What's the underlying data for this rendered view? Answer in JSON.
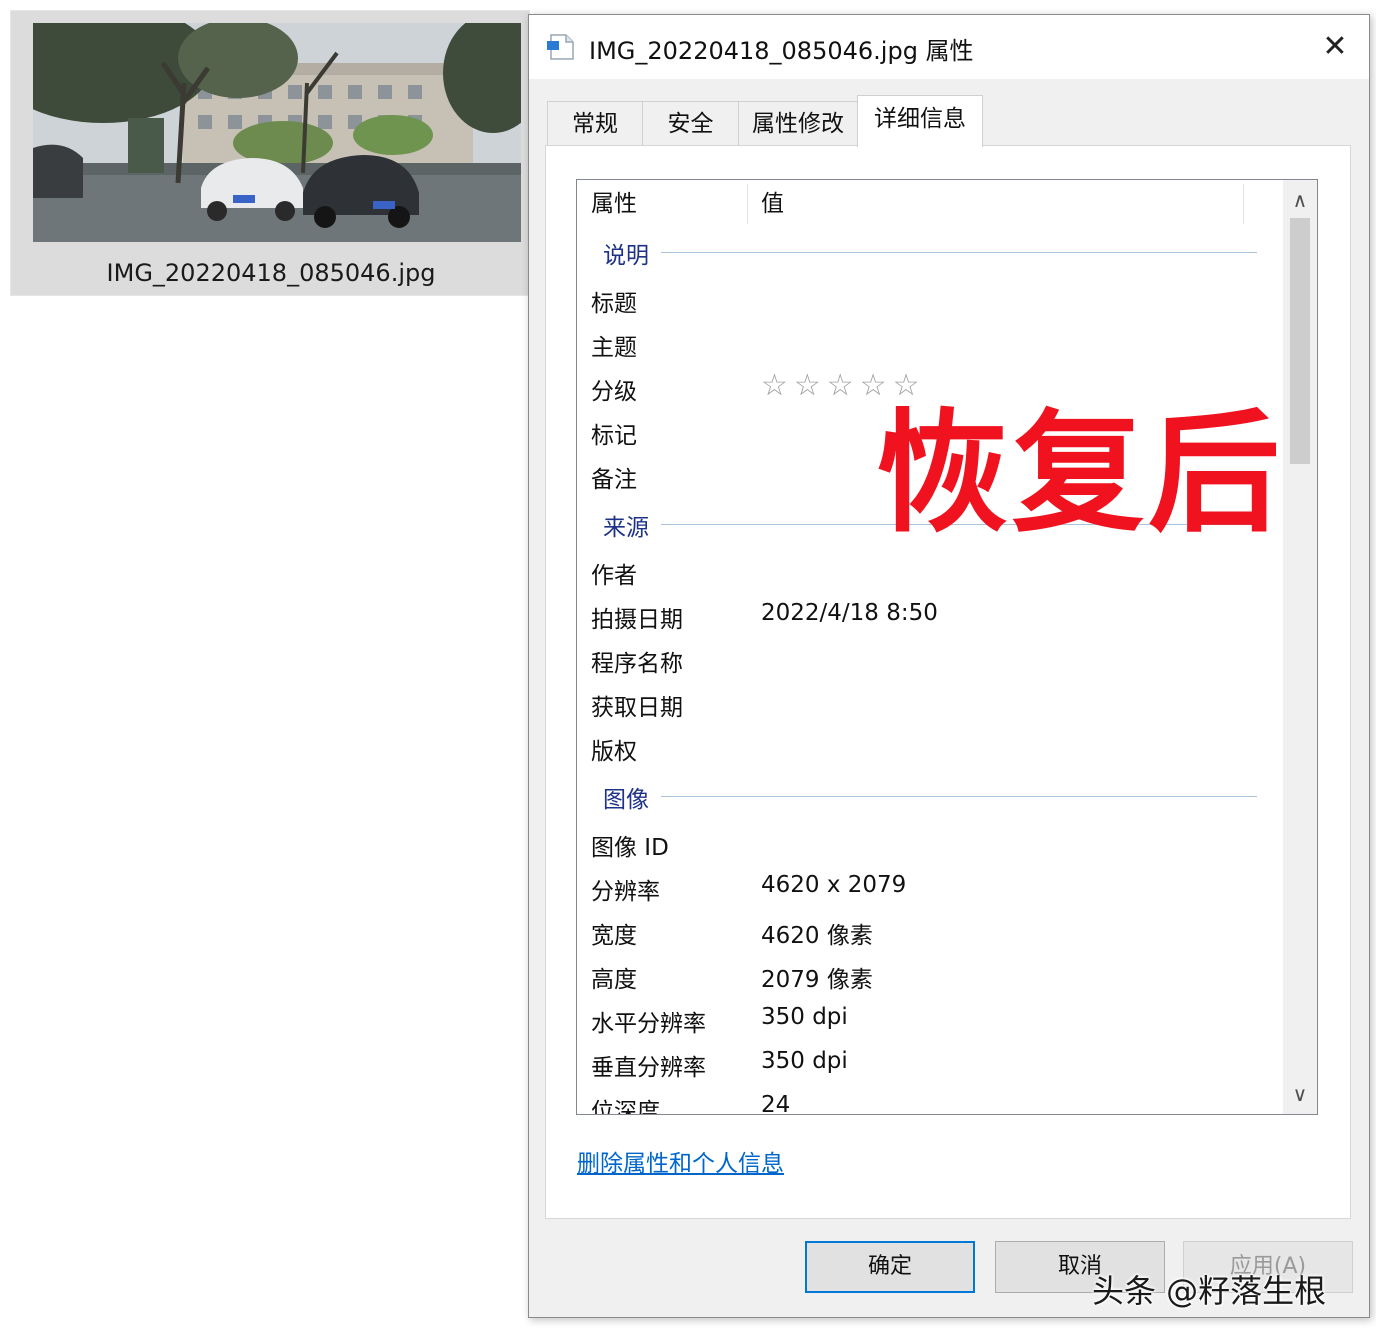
{
  "explorer": {
    "file_name": "IMG_20220418_085046.jpg",
    "thumbnail_icon": "photo-thumbnail"
  },
  "dialog": {
    "title": "IMG_20220418_085046.jpg 属性",
    "close_glyph": "✕",
    "tabs": [
      {
        "label": "常规",
        "active": false
      },
      {
        "label": "安全",
        "active": false
      },
      {
        "label": "属性修改",
        "active": false
      },
      {
        "label": "详细信息",
        "active": true
      }
    ],
    "columns": {
      "property": "属性",
      "value": "值"
    },
    "groups": {
      "description": "说明",
      "origin": "来源",
      "image": "图像"
    },
    "rows": {
      "title": {
        "label": "标题",
        "value": ""
      },
      "subject": {
        "label": "主题",
        "value": ""
      },
      "rating": {
        "label": "分级",
        "stars": "☆☆☆☆☆",
        "rating": 0,
        "max": 5
      },
      "tags": {
        "label": "标记",
        "value": ""
      },
      "comments": {
        "label": "备注",
        "value": ""
      },
      "authors": {
        "label": "作者",
        "value": ""
      },
      "date_taken": {
        "label": "拍摄日期",
        "value": "2022/4/18 8:50"
      },
      "program": {
        "label": "程序名称",
        "value": ""
      },
      "date_acquired": {
        "label": "获取日期",
        "value": ""
      },
      "copyright": {
        "label": "版权",
        "value": ""
      },
      "image_id": {
        "label": "图像 ID",
        "value": ""
      },
      "dimensions": {
        "label": "分辨率",
        "value": "4620 x 2079"
      },
      "width": {
        "label": "宽度",
        "value": "4620 像素"
      },
      "height": {
        "label": "高度",
        "value": "2079 像素"
      },
      "h_res": {
        "label": "水平分辨率",
        "value": "350 dpi"
      },
      "v_res": {
        "label": "垂直分辨率",
        "value": "350 dpi"
      },
      "bit_depth": {
        "label": "位深度",
        "value": "24"
      }
    },
    "scroll_up": "∧",
    "scroll_down": "∨",
    "remove_link": "删除属性和个人信息",
    "buttons": {
      "ok": "确定",
      "cancel": "取消",
      "apply": "应用(A)"
    }
  },
  "overlay_text": "恢复后",
  "watermark": "头条 @籽落生根",
  "colors": {
    "overlay_red": "#f0121e",
    "group_blue": "#1e3287",
    "link_blue": "#0066cc",
    "focus_blue": "#0078d7"
  }
}
